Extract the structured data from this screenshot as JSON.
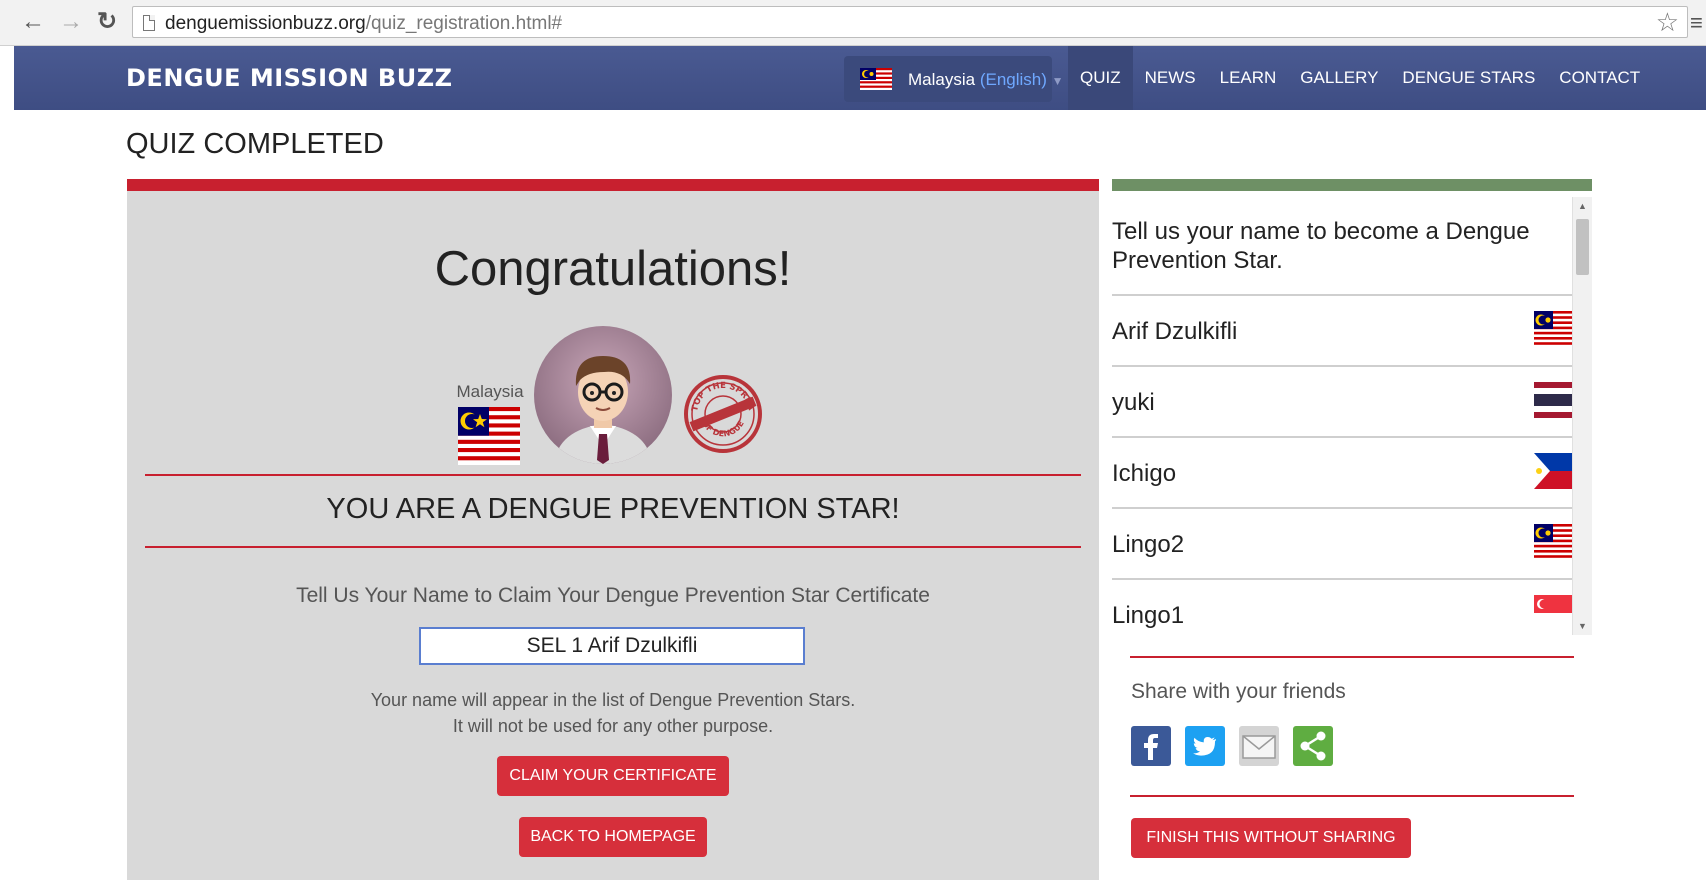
{
  "browser": {
    "url_domain": "denguemissionbuzz.org",
    "url_path": "/quiz_registration.html#"
  },
  "nav": {
    "brand": "DENGUE MISSION BUZZ",
    "country": "Malaysia",
    "language": "(English)",
    "links": [
      "QUIZ",
      "NEWS",
      "LEARN",
      "GALLERY",
      "DENGUE STARS",
      "CONTACT"
    ],
    "active": "QUIZ"
  },
  "page": {
    "title": "QUIZ COMPLETED"
  },
  "main": {
    "congrats": "Congratulations!",
    "country_label": "Malaysia",
    "stamp_text_top": "STOP THE SPREAD",
    "stamp_text_bottom": "OF DENGUE",
    "headline": "YOU ARE A DENGUE PREVENTION STAR!",
    "claim_prompt": "Tell Us Your Name to Claim Your Dengue Prevention Star Certificate",
    "name_value": "SEL 1 Arif Dzulkifli",
    "note_line1": "Your name will appear in the list of Dengue Prevention Stars.",
    "note_line2": "It will not be used for any other purpose.",
    "claim_button": "CLAIM YOUR CERTIFICATE",
    "home_button": "BACK TO HOMEPAGE"
  },
  "side": {
    "intro": "Tell us your name to become a Dengue Prevention Star.",
    "stars": [
      {
        "name": "Arif Dzulkifli",
        "flag": "malaysia"
      },
      {
        "name": "yuki",
        "flag": "thailand"
      },
      {
        "name": "Ichigo",
        "flag": "philippines"
      },
      {
        "name": "Lingo2",
        "flag": "malaysia"
      },
      {
        "name": "Lingo1",
        "flag": "singapore"
      }
    ],
    "share_title": "Share with your friends",
    "share_icons": [
      "facebook-icon",
      "twitter-icon",
      "email-icon",
      "share-icon"
    ],
    "finish_button": "FINISH THIS WITHOUT SHARING"
  },
  "colors": {
    "nav_bg": "#4a5a92",
    "accent_red": "#c8202f",
    "button_red": "#d62f3b",
    "side_accent": "#6e9065",
    "panel_bg": "#d9d9d9"
  }
}
